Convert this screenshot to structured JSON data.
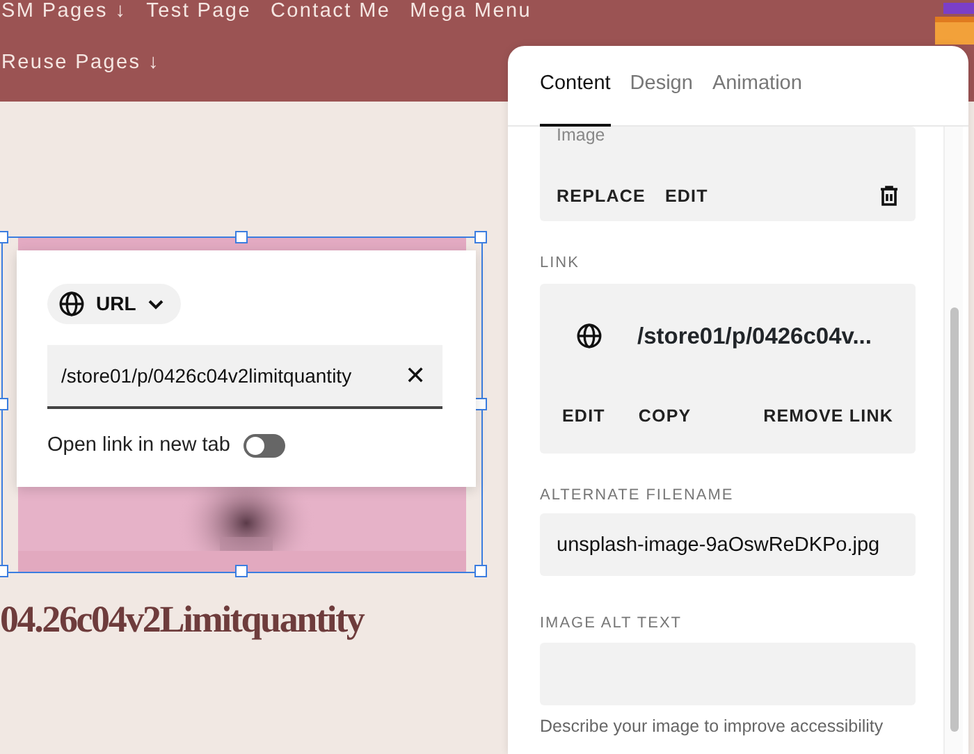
{
  "nav": {
    "rows": [
      [
        {
          "label": "SM Pages",
          "arrow": "↓"
        },
        {
          "label": "Test Page"
        },
        {
          "label": "Contact Me"
        },
        {
          "label": "Mega Menu"
        }
      ],
      [
        {
          "label": "Reuse Pages",
          "arrow": "↓"
        }
      ]
    ]
  },
  "canvas": {
    "image": {
      "kind": "picture",
      "selected": true
    },
    "link_popup": {
      "type_label": "URL",
      "url": "/store01/p/0426c04v2limitquantity",
      "clear": "✕",
      "new_tab_label": "Open link in new tab",
      "new_tab_on": false
    },
    "product_title": "04.26c04v2Limitquantity"
  },
  "panel": {
    "tabs": [
      {
        "label": "Content",
        "selected": true
      },
      {
        "label": "Design",
        "selected": false
      },
      {
        "label": "Animation",
        "selected": false
      }
    ],
    "image_box": {
      "label": "Image",
      "actions": [
        "REPLACE",
        "EDIT"
      ]
    },
    "link": {
      "heading": "LINK",
      "url": "/store01/p/0426c04v...",
      "actions": [
        "EDIT",
        "COPY",
        "REMOVE LINK"
      ]
    },
    "alternate_filename": {
      "heading": "ALTERNATE FILENAME",
      "value": "unsplash-image-9aOswReDKPo.jpg"
    },
    "alt_text": {
      "heading": "IMAGE ALT TEXT",
      "help": "Describe your image to improve accessibility"
    }
  }
}
